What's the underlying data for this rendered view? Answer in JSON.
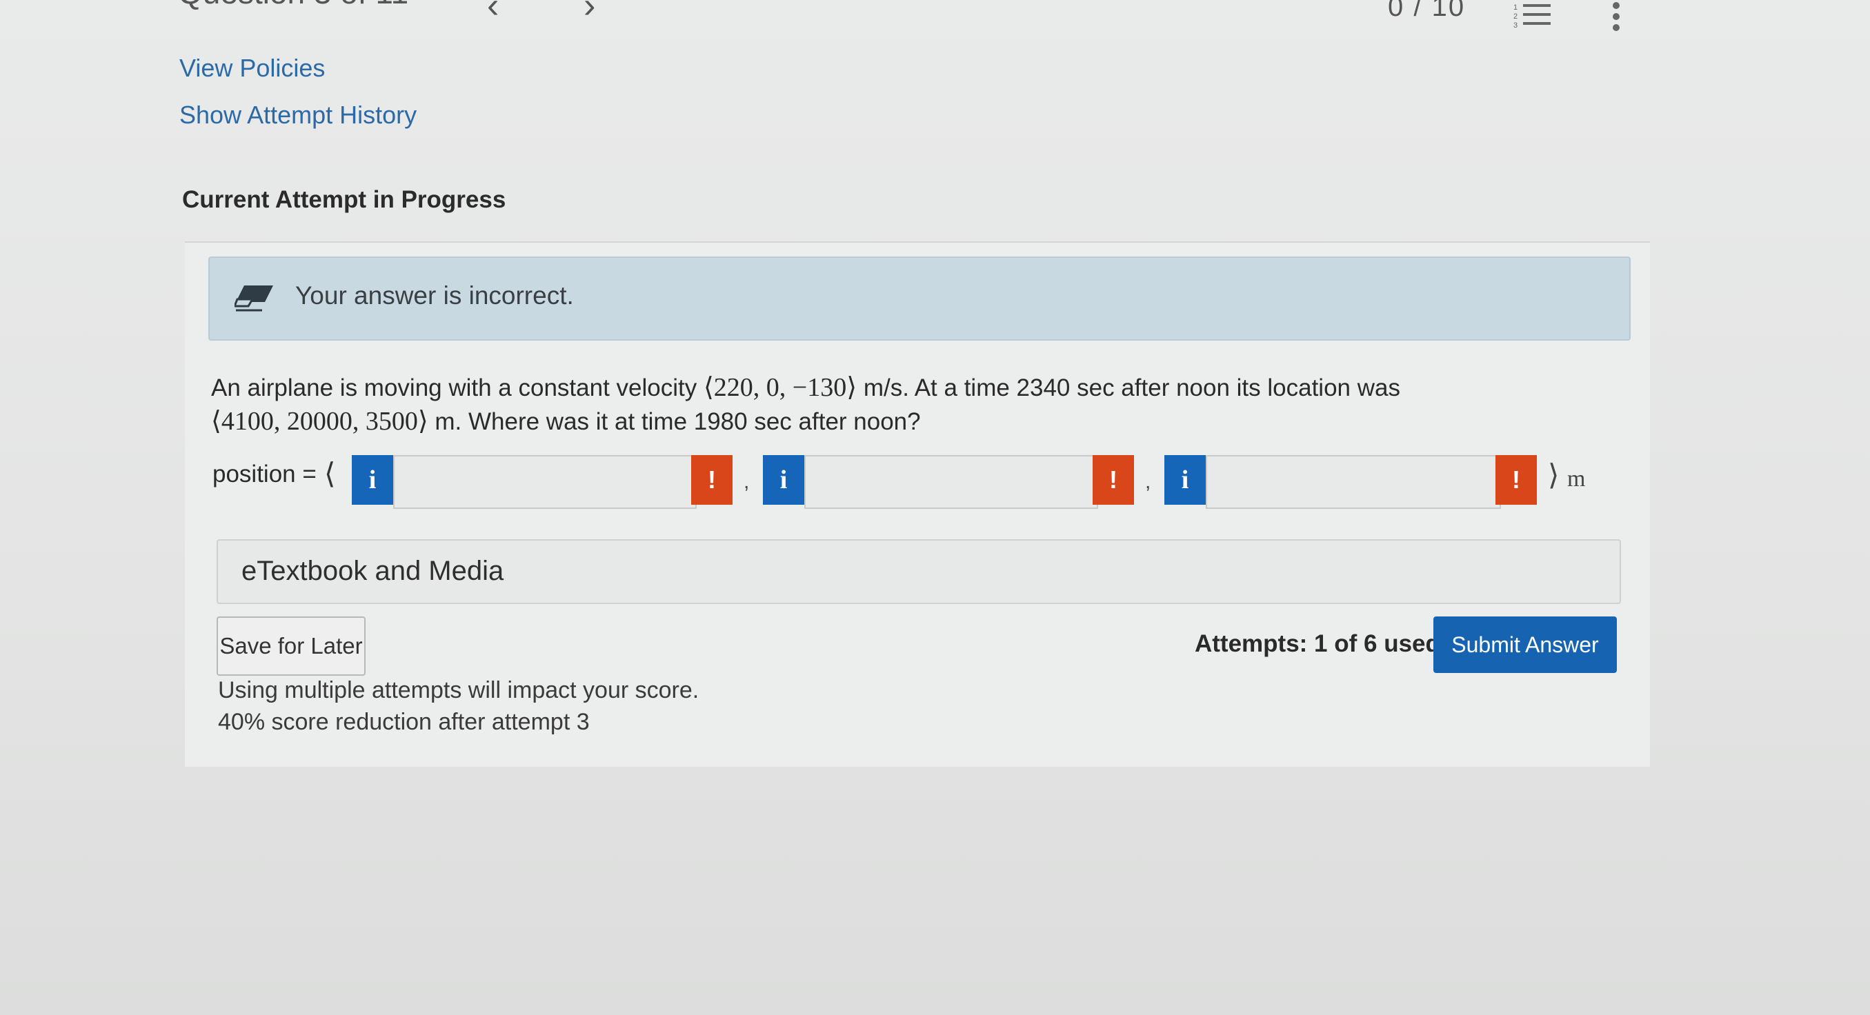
{
  "header": {
    "question_title": "Question 3 of 11",
    "prev_arrow": "‹",
    "next_arrow": "›",
    "score": "0 / 10",
    "list_icon": "numbered-list-icon",
    "more_icon": "more-vertical-icon"
  },
  "links": {
    "view_policies": "View Policies",
    "attempt_history": "Show Attempt History"
  },
  "section_title": "Current Attempt in Progress",
  "alert": {
    "icon": "eraser-icon",
    "text": "Your answer is incorrect."
  },
  "question": {
    "part1": "An airplane is moving with a constant velocity",
    "velocity": "⟨220, 0, −130⟩",
    "part2": "m/s. At a time 2340 sec after noon its location was",
    "location": "⟨4100, 20000, 3500⟩",
    "part3": "m. Where was it at time 1980 sec after noon?"
  },
  "answer": {
    "label": "position =",
    "open": "⟨",
    "close": "⟩",
    "unit": "m",
    "separator": ",",
    "info_glyph": "i",
    "error_glyph": "!",
    "fields": [
      "",
      "",
      ""
    ]
  },
  "etextbook": {
    "label": "eTextbook and Media"
  },
  "actions": {
    "save_label": "Save for Later",
    "attempts": "Attempts: 1 of 6 used",
    "submit_label": "Submit Answer"
  },
  "notes": {
    "line1": "Using multiple attempts will impact your score.",
    "line2": "40% score reduction after attempt 3"
  },
  "colors": {
    "link": "#2b6aa8",
    "info_button": "#1566b8",
    "error_button": "#d9461a",
    "submit_button": "#1663b1",
    "alert_bg": "#c9d9e2"
  }
}
